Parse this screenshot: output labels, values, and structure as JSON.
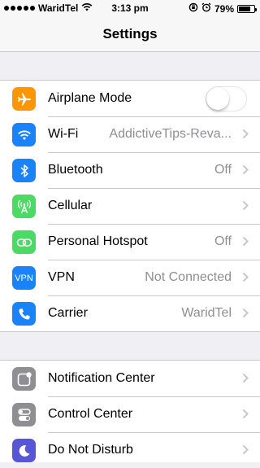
{
  "status_bar": {
    "carrier": "WaridTel",
    "time": "3:13 pm",
    "battery": "79%",
    "battery_level": 0.79,
    "signal_bars": 5
  },
  "nav": {
    "title": "Settings"
  },
  "colors": {
    "airplane": "#ff9500",
    "wifi": "#1a82fb",
    "bluetooth": "#1a82fb",
    "cellular": "#4cd964",
    "hotspot": "#4cd964",
    "vpn": "#1a82fb",
    "carrier": "#1a82fb",
    "notifications": "#8e8e93",
    "control_center": "#8e8e93",
    "dnd": "#5856d6"
  },
  "group1": [
    {
      "icon": "airplane-icon",
      "label": "Airplane Mode",
      "toggle_on": false
    },
    {
      "icon": "wifi-icon",
      "label": "Wi-Fi",
      "value": "AddictiveTips-Reva..."
    },
    {
      "icon": "bluetooth-icon",
      "label": "Bluetooth",
      "value": "Off"
    },
    {
      "icon": "cellular-antenna-icon",
      "label": "Cellular"
    },
    {
      "icon": "hotspot-icon",
      "label": "Personal Hotspot",
      "value": "Off"
    },
    {
      "icon": "vpn-icon",
      "icon_text": "VPN",
      "label": "VPN",
      "value": "Not Connected"
    },
    {
      "icon": "phone-icon",
      "label": "Carrier",
      "value": "WaridTel"
    }
  ],
  "group2": [
    {
      "icon": "notification-center-icon",
      "label": "Notification Center"
    },
    {
      "icon": "control-center-icon",
      "label": "Control Center"
    },
    {
      "icon": "moon-icon",
      "label": "Do Not Disturb"
    }
  ]
}
